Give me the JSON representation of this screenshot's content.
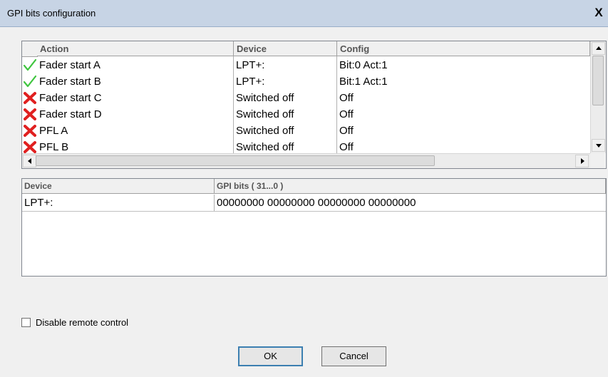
{
  "dialog": {
    "title": "GPI bits configuration",
    "close_glyph": "X"
  },
  "actions_grid": {
    "columns": [
      "Action",
      "Device",
      "Config"
    ],
    "rows": [
      {
        "status": "check-icon",
        "action": "Fader start A",
        "device": "LPT+:",
        "config": "Bit:0 Act:1"
      },
      {
        "status": "check-icon",
        "action": "Fader start B",
        "device": "LPT+:",
        "config": "Bit:1 Act:1"
      },
      {
        "status": "cross-icon",
        "action": "Fader start C",
        "device": "Switched off",
        "config": "Off"
      },
      {
        "status": "cross-icon",
        "action": "Fader start D",
        "device": "Switched off",
        "config": "Off"
      },
      {
        "status": "cross-icon",
        "action": "PFL A",
        "device": "Switched off",
        "config": "Off"
      },
      {
        "status": "cross-icon",
        "action": "PFL B",
        "device": "Switched off",
        "config": "Off"
      }
    ]
  },
  "gpi_grid": {
    "columns": [
      "Device",
      "GPI bits ( 31...0 )"
    ],
    "rows": [
      {
        "device": "LPT+:",
        "bits": "00000000 00000000 00000000 00000000"
      }
    ]
  },
  "disable_remote": {
    "label": "Disable remote control",
    "checked": false
  },
  "buttons": {
    "ok": "OK",
    "cancel": "Cancel"
  }
}
